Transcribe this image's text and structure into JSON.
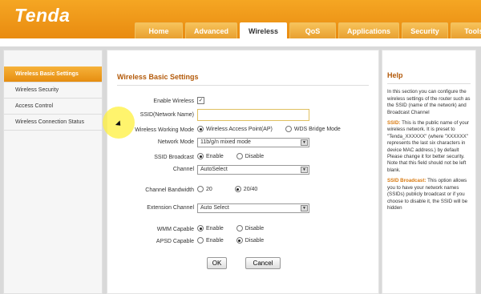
{
  "brand": "Tenda",
  "tabs": [
    "Home",
    "Advanced",
    "Wireless",
    "QoS",
    "Applications",
    "Security",
    "Tools"
  ],
  "sidebar": {
    "items": [
      "Wireless Basic Settings",
      "Wireless Security",
      "Access Control",
      "Wireless Connection Status"
    ]
  },
  "main": {
    "title": "Wireless Basic Settings",
    "enable_wireless_label": "Enable Wireless",
    "ssid_label": "SSID(Network Name)",
    "ssid_value": "",
    "working_mode_label": "Wireless Working Mode",
    "working_mode_ap": "Wireless Access Point(AP)",
    "working_mode_wds": "WDS Bridge Mode",
    "network_mode_label": "Network Mode",
    "network_mode_value": "11b/g/n mixed mode",
    "ssid_broadcast_label": "SSID Broadcast",
    "enable_label": "Enable",
    "disable_label": "Disable",
    "channel_label": "Channel",
    "channel_value": "AutoSelect",
    "bandwidth_label": "Channel Bandwidth",
    "bandwidth_20": "20",
    "bandwidth_2040": "20/40",
    "ext_channel_label": "Extension Channel",
    "ext_channel_value": "Auto Select",
    "wmm_label": "WMM Capable",
    "apsd_label": "APSD Capable",
    "ok_label": "OK",
    "cancel_label": "Cancel"
  },
  "help": {
    "title": "Help",
    "intro": "In this section you can configure the wireless settings of the router such as the SSID (name of the network) and Broadcast Channel",
    "ssid_term": "SSID:",
    "ssid_text": " This is the public name of your wireless network. It is preset to \"Tenda_XXXXXX\" (where \"XXXXXX\" represents the last six characters in device MAC address.) by default Please change it for better security. Note that this field should not be left blank.",
    "broadcast_term": "SSID Broadcast:",
    "broadcast_text": " This option allows you to have your network names (SSIDs) publicly broadcast or if you choose to disable it, the SSID will be hidden"
  },
  "colors": {
    "accent": "#e98b10",
    "title": "#b35a0a"
  }
}
